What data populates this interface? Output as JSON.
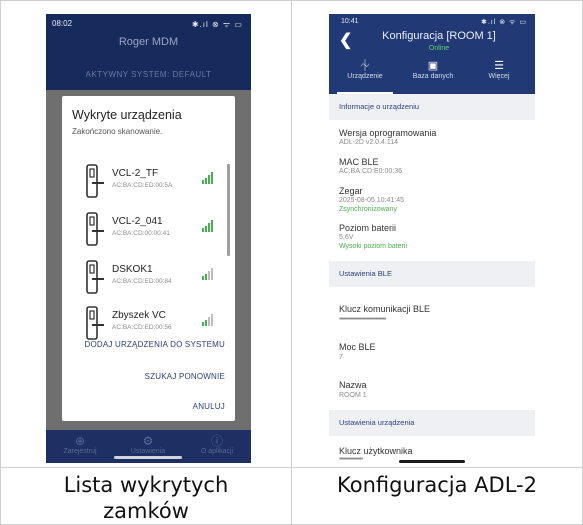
{
  "captions": {
    "left": "Lista wykrytych zamków",
    "right": "Konfiguracja ADL-2"
  },
  "left_phone": {
    "status_time": "08:02",
    "status_icons": "✱.ıl ⊗ ᯤ ▭",
    "app_title": "Roger MDM",
    "system_label": "AKTYWNY SYSTEM: DEFAULT",
    "dialog": {
      "title": "Wykryte urządzenia",
      "subtitle": "Zakończono skanowanie.",
      "devices": [
        {
          "name": "VCL-2_TF",
          "mac": "AC:BA:CD:ED:00:5A",
          "signal": 4
        },
        {
          "name": "VCL-2_041",
          "mac": "AC:BA:CD:00:00:41",
          "signal": 4
        },
        {
          "name": "DSKOK1",
          "mac": "AC:BA:CD:ED:00:84",
          "signal": 2
        },
        {
          "name": "Zbyszek VC",
          "mac": "AC:BA:CD:ED:00:56",
          "signal": 2
        }
      ],
      "add_button": "DODAJ URZĄDZENIA DO SYSTEMU",
      "rescan_button": "SZUKAJ PONOWNIE",
      "cancel_button": "ANULUJ"
    },
    "bottom_nav": [
      {
        "label": "Zarejestruj",
        "icon": "plus-circle-icon"
      },
      {
        "label": "Ustawienia",
        "icon": "gear-icon"
      },
      {
        "label": "O aplikacji",
        "icon": "info-icon"
      }
    ]
  },
  "right_phone": {
    "status_time": "10:41",
    "status_icons": "✱.ıl ⊗ ᯤ ▭",
    "title": "Konfiguracja [ROOM 1]",
    "online": "Online",
    "tabs": [
      {
        "label": "Urządzenie",
        "icon": "device-icon"
      },
      {
        "label": "Baza danych",
        "icon": "database-icon"
      },
      {
        "label": "Więcej",
        "icon": "menu-icon"
      }
    ],
    "section_info": "Informacje o urządzeniu",
    "fw_label": "Wersja oprogramowania",
    "fw_value": "ADL-2D v2.0.4.114",
    "mac_label": "MAC BLE",
    "mac_value": "AC:BA:CD:E0:00:36",
    "clock_label": "Zegar",
    "clock_value": "2025-08-05 10:41:45",
    "clock_status": "Zsynchronizowany",
    "battery_label": "Poziom baterii",
    "battery_value": "5,6V",
    "battery_status": "Wysoki poziom baterii",
    "section_ble": "Ustawienia BLE",
    "key_label": "Klucz komunikacji BLE",
    "key_value": "••••••••••••••••••••••••••••••••",
    "power_label": "Moc BLE",
    "power_value": "7",
    "name_label": "Nazwa",
    "name_value": "ROOM 1",
    "section_device": "Ustawienia urządzenia",
    "user_key_label": "Klucz użytkownika",
    "user_key_value": "••••••••••••••••"
  },
  "colors": {
    "header_blue": "#213974",
    "online_green": "#5fd46b",
    "accent": "#2c3f7a"
  }
}
